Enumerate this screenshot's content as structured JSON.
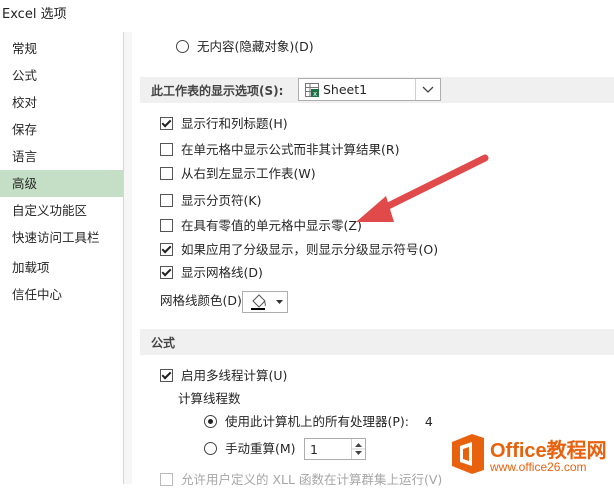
{
  "window": {
    "title": "Excel 选项"
  },
  "sidebar": {
    "items": [
      {
        "label": "常规",
        "selected": false
      },
      {
        "label": "公式",
        "selected": false
      },
      {
        "label": "校对",
        "selected": false
      },
      {
        "label": "保存",
        "selected": false
      },
      {
        "label": "语言",
        "selected": false
      },
      {
        "label": "高级",
        "selected": true
      },
      {
        "label": "自定义功能区",
        "selected": false
      },
      {
        "label": "快速访问工具栏",
        "selected": false
      },
      {
        "label": "加载项",
        "selected": false
      },
      {
        "label": "信任中心",
        "selected": false
      }
    ]
  },
  "content": {
    "no_content_radio": {
      "label": "无内容(隐藏对象)(D)",
      "checked": false
    },
    "sheet_section": {
      "title": "此工作表的显示选项(S):",
      "selected_sheet": "Sheet1",
      "options": [
        {
          "label": "显示行和列标题(H)",
          "checked": true
        },
        {
          "label": "在单元格中显示公式而非其计算结果(R)",
          "checked": false
        },
        {
          "label": "从右到左显示工作表(W)",
          "checked": false
        },
        {
          "label": "显示分页符(K)",
          "checked": false
        },
        {
          "label": "在具有零值的单元格中显示零(Z)",
          "checked": false
        },
        {
          "label": "如果应用了分级显示，则显示分级显示符号(O)",
          "checked": true
        },
        {
          "label": "显示网格线(D)",
          "checked": true
        }
      ],
      "gridline_color_label": "网格线颜色(D)"
    },
    "formula_section": {
      "title": "公式",
      "multithread": {
        "label": "启用多线程计算(U)",
        "checked": true
      },
      "thread_count_label": "计算线程数",
      "all_processors": {
        "label": "使用此计算机上的所有处理器(P):",
        "value": "4",
        "checked": true
      },
      "manual": {
        "label": "手动重算(M)",
        "value": "1",
        "checked": false
      },
      "xll_option": {
        "label": "允许用户定义的 XLL 函数在计算群集上运行(V)",
        "checked": false
      }
    }
  },
  "watermark": {
    "brand": "Office教程网",
    "url": "www.office26.com"
  },
  "colors": {
    "accent": "#c5dfc6",
    "arrow": "#e04a4a",
    "logo": "#e8620e"
  }
}
